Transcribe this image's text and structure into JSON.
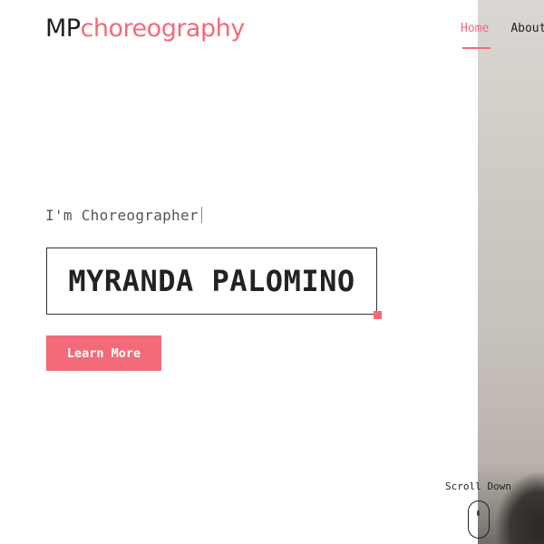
{
  "brand": {
    "initials": "MP",
    "word": "choreography",
    "accent_color": "#f36b7a"
  },
  "nav": {
    "items": [
      {
        "label": "Home",
        "active": true
      },
      {
        "label": "About",
        "active": false
      }
    ]
  },
  "hero": {
    "tagline": "I'm Choreographer",
    "name": "MYRANDA PALOMINO",
    "cta_label": "Learn More"
  },
  "scroll": {
    "label": "Scroll Down",
    "icon": "mouse-icon"
  }
}
